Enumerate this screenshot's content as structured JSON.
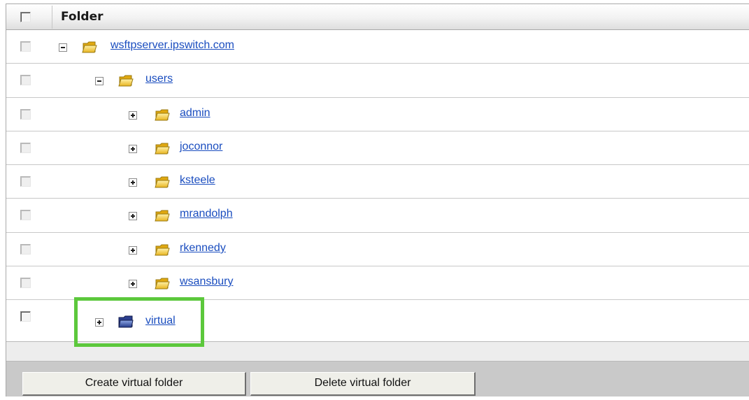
{
  "table": {
    "header": {
      "label": "Folder"
    },
    "rows": [
      {
        "name": "wsftpserver.ipswitch.com",
        "toggle": "collapse",
        "icon": "folder-icon"
      },
      {
        "name": "users",
        "toggle": "collapse",
        "icon": "folder-icon"
      },
      {
        "name": "admin",
        "toggle": "expand",
        "icon": "folder-icon"
      },
      {
        "name": "joconnor",
        "toggle": "expand",
        "icon": "folder-icon"
      },
      {
        "name": "ksteele",
        "toggle": "expand",
        "icon": "folder-icon"
      },
      {
        "name": "mrandolph",
        "toggle": "expand",
        "icon": "folder-icon"
      },
      {
        "name": "rkennedy",
        "toggle": "expand",
        "icon": "folder-icon"
      },
      {
        "name": "wsansbury",
        "toggle": "expand",
        "icon": "folder-icon"
      },
      {
        "name": "virtual",
        "toggle": "expand",
        "icon": "virtual-folder-icon"
      }
    ]
  },
  "toolbar": {
    "create_label": "Create virtual folder",
    "delete_label": "Delete virtual folder"
  },
  "colors": {
    "link": "#1a4dbf",
    "highlight": "#5cc83c",
    "folder": "#f5c518",
    "virtual_folder": "#2c3f8f"
  }
}
